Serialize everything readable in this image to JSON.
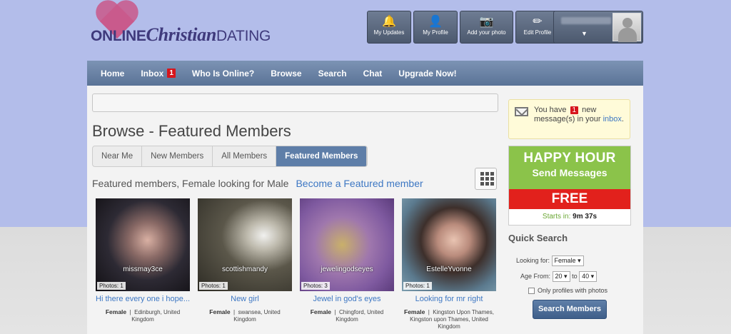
{
  "logo": {
    "part1": "ONLINE",
    "part2": "Christian",
    "part3": "DATING"
  },
  "top_buttons": [
    {
      "label": "My Updates",
      "icon": "bell-icon"
    },
    {
      "label": "My Profile",
      "icon": "person-icon"
    },
    {
      "label": "Add your photo",
      "icon": "camera-icon"
    },
    {
      "label": "Edit Profile",
      "icon": "pencil-icon"
    }
  ],
  "account": {
    "arrow": "▼"
  },
  "nav": {
    "home": "Home",
    "inbox": "Inbox",
    "inbox_count": "1",
    "who_online": "Who Is Online?",
    "browse": "Browse",
    "search": "Search",
    "chat": "Chat",
    "upgrade": "Upgrade Now!"
  },
  "page_title": "Browse - Featured Members",
  "tabs": [
    "Near Me",
    "New Members",
    "All Members",
    "Featured Members"
  ],
  "subtitle": "Featured members, Female looking for Male",
  "become_featured": "Become a Featured member",
  "members": [
    {
      "username": "missmay3ce",
      "photos": "Photos: 1",
      "headline": "Hi there every one i hope...",
      "gender": "Female",
      "location": "Edinburgh, United Kingdom"
    },
    {
      "username": "scottishmandy",
      "photos": "Photos: 1",
      "headline": "New girl",
      "gender": "Female",
      "location": "swansea, United Kingdom"
    },
    {
      "username": "jewelingodseyes",
      "photos": "Photos: 3",
      "headline": "Jewel in god's eyes",
      "gender": "Female",
      "location": "Chingford, United Kingdom"
    },
    {
      "username": "EstelleYvonne",
      "photos": "Photos: 1",
      "headline": "Looking for mr right",
      "gender": "Female",
      "location": "Kingston Upon Thames, Kingston upon Thames, United Kingdom"
    }
  ],
  "message_box": {
    "pre": "You have",
    "count": "1",
    "post": "new message(s) in your",
    "link": "inbox",
    "end": "."
  },
  "happy_hour": {
    "title": "HAPPY HOUR",
    "subtitle": "Send Messages",
    "free": "FREE",
    "starts_label": "Starts in:",
    "countdown": "9m 37s"
  },
  "quick_search": {
    "title": "Quick Search",
    "looking_for_label": "Looking for:",
    "looking_for_value": "Female",
    "age_from_label": "Age From:",
    "age_from": "20",
    "to_label": "to",
    "age_to": "40",
    "photos_only": "Only profiles with photos",
    "button": "Search Members"
  }
}
